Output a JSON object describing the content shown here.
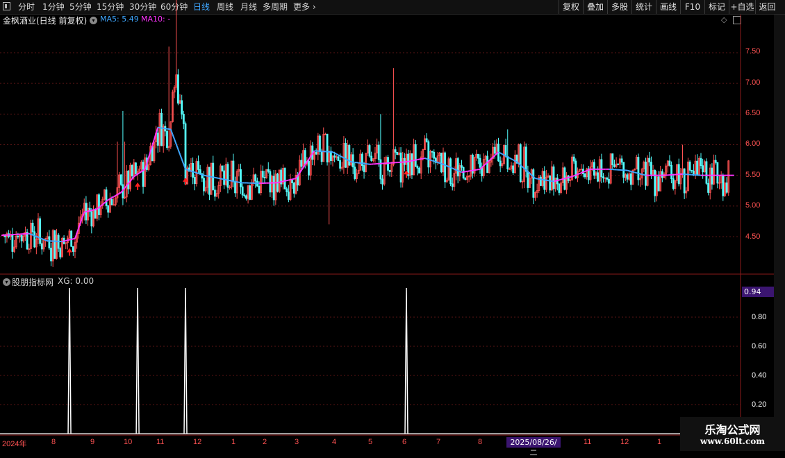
{
  "toolbar": {
    "periods": [
      "分时",
      "1分钟",
      "5分钟",
      "15分钟",
      "30分钟",
      "60分钟",
      "日线",
      "周线",
      "月线",
      "多周期",
      "更多"
    ],
    "active_period": "日线",
    "right_buttons": [
      "复权",
      "叠加",
      "多股",
      "统计",
      "画线",
      "F10",
      "标记",
      "+自选",
      "返回"
    ]
  },
  "main_panel": {
    "stock_title": "金枫酒业(日线 前复权)",
    "ma5_label": "MA5: 5.49",
    "ma10_label": "MA10: -",
    "price_axis": [
      "7.50",
      "7.00",
      "6.50",
      "6.00",
      "5.50",
      "5.00",
      "4.50"
    ]
  },
  "sub_panel": {
    "indicator_name": "股朋指标网",
    "xg_label": "XG: 0.00",
    "value_badge": "0.94",
    "axis": [
      "0.80",
      "0.60",
      "0.40",
      "0.20"
    ]
  },
  "x_axis": {
    "labels": [
      "2024年",
      "8",
      "9",
      "10",
      "11",
      "12",
      "1",
      "2",
      "3",
      "4",
      "5",
      "6",
      "7",
      "8",
      "11",
      "12",
      "1"
    ],
    "cursor_date": "2025/08/26/二"
  },
  "watermark": {
    "line1": "乐淘公式网",
    "line2": "www.60lt.com"
  },
  "colors": {
    "up": "#ff5252",
    "down": "#54ffff",
    "ma_up": "#ff33ff",
    "ma_down": "#3ea6ff",
    "badge": "#3b1570"
  },
  "chart_data": {
    "type": "line",
    "price_range": [
      4.0,
      8.0
    ],
    "ma_line": {
      "x_days": [
        0,
        15,
        25,
        33,
        40,
        45,
        52,
        58,
        65,
        72,
        78,
        85,
        92,
        100,
        110,
        120,
        130,
        140,
        150,
        160,
        170,
        180,
        190,
        200,
        210,
        220,
        230,
        240,
        250,
        260,
        270,
        280,
        290,
        300,
        310,
        320,
        330,
        340,
        350,
        360,
        370,
        380,
        390,
        398
      ],
      "y": [
        4.52,
        4.55,
        4.43,
        4.42,
        4.47,
        4.9,
        4.95,
        5.1,
        5.22,
        5.48,
        5.6,
        6.28,
        6.25,
        5.6,
        5.5,
        5.44,
        5.38,
        5.37,
        5.38,
        5.45,
        5.9,
        5.88,
        5.72,
        5.68,
        5.7,
        5.72,
        5.78,
        5.68,
        5.55,
        5.6,
        5.88,
        5.72,
        5.45,
        5.4,
        5.48,
        5.6,
        5.6,
        5.58,
        5.5,
        5.5,
        5.52,
        5.5,
        5.5,
        5.5
      ]
    },
    "signal_days": [
      37,
      74,
      100,
      220
    ],
    "signal_value": 1.0
  }
}
